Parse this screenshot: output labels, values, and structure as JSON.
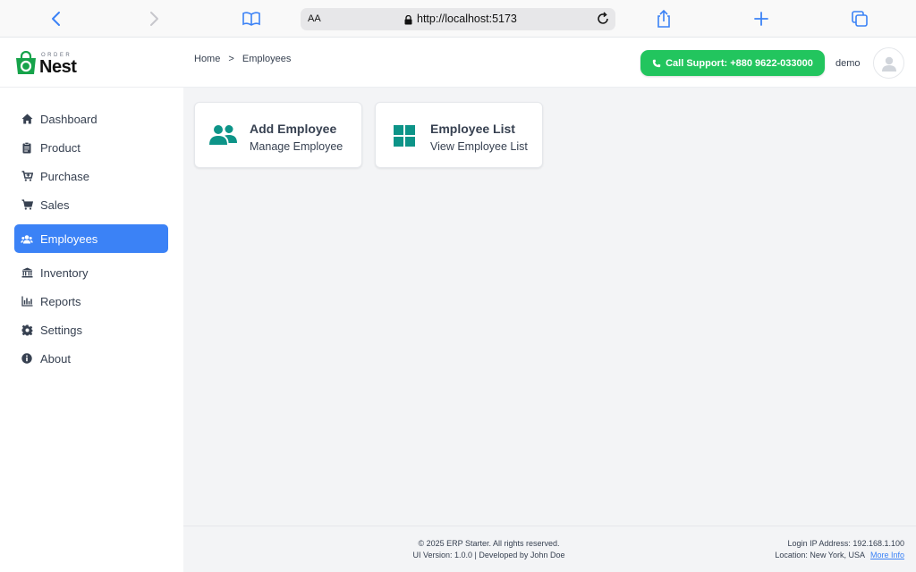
{
  "browser": {
    "text_size_label": "AA",
    "url": "http://localhost:5173"
  },
  "app": {
    "logo_small": "ORDER",
    "logo_main": "Nest"
  },
  "breadcrumb": {
    "home": "Home",
    "separator": ">",
    "current": "Employees"
  },
  "header": {
    "support_label": "Call Support: +880 9622-033000",
    "username": "demo"
  },
  "sidebar": {
    "items": [
      {
        "label": "Dashboard",
        "icon": "home-icon"
      },
      {
        "label": "Product",
        "icon": "clipboard-icon"
      },
      {
        "label": "Purchase",
        "icon": "cart-plus-icon"
      },
      {
        "label": "Sales",
        "icon": "cart-icon"
      },
      {
        "label": "Employees",
        "icon": "users-icon",
        "active": true
      },
      {
        "label": "Inventory",
        "icon": "bank-icon"
      },
      {
        "label": "Reports",
        "icon": "bar-chart-icon"
      },
      {
        "label": "Settings",
        "icon": "gear-icon"
      },
      {
        "label": "About",
        "icon": "info-icon"
      }
    ]
  },
  "cards": [
    {
      "title": "Add Employee",
      "subtitle": "Manage Employee",
      "icon": "users-icon"
    },
    {
      "title": "Employee List",
      "subtitle": "View Employee List",
      "icon": "grid-icon"
    }
  ],
  "footer": {
    "copyright": "© 2025 ERP Starter. All rights reserved.",
    "version": "UI Version: 1.0.0 | Developed by John Doe",
    "ip": "Login IP Address: 192.168.1.100",
    "location": "Location: New York, USA",
    "more_info": "More Info"
  },
  "colors": {
    "accent": "#3b82f6",
    "support": "#22c55e",
    "card_icon": "#0d9488",
    "logo_green": "#16a34a"
  }
}
